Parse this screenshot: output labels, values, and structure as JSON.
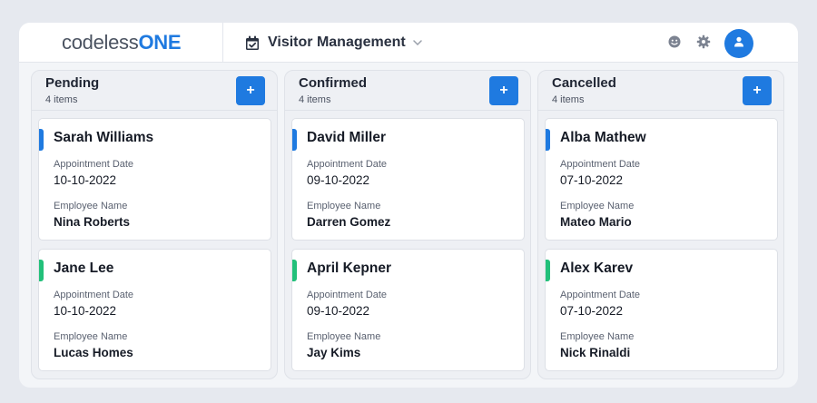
{
  "header": {
    "logo_light": "codeless",
    "logo_heavy": "ONE",
    "app_title": "Visitor Management"
  },
  "colors": {
    "accent": "#1f7ae0",
    "pending_stripe": "#1f7ae0",
    "green_stripe": "#22c07a"
  },
  "icons": [
    "calendar-check-icon",
    "chevron-down-icon",
    "smiley-icon",
    "gear-icon",
    "user-icon",
    "plus-icon"
  ],
  "labels": {
    "date": "Appointment Date",
    "employee": "Employee Name",
    "add": "+"
  },
  "columns": [
    {
      "title": "Pending",
      "count": "4 items",
      "cards": [
        {
          "name": "Sarah Williams",
          "date": "10-10-2022",
          "employee": "Nina Roberts",
          "stripe": "blue"
        },
        {
          "name": "Jane Lee",
          "date": "10-10-2022",
          "employee": "Lucas Homes",
          "stripe": "green"
        }
      ]
    },
    {
      "title": "Confirmed",
      "count": "4 items",
      "cards": [
        {
          "name": "David Miller",
          "date": "09-10-2022",
          "employee": "Darren Gomez",
          "stripe": "blue"
        },
        {
          "name": "April Kepner",
          "date": "09-10-2022",
          "employee": "Jay Kims",
          "stripe": "green"
        }
      ]
    },
    {
      "title": "Cancelled",
      "count": "4 items",
      "cards": [
        {
          "name": "Alba Mathew",
          "date": "07-10-2022",
          "employee": "Mateo Mario",
          "stripe": "blue"
        },
        {
          "name": "Alex Karev",
          "date": "07-10-2022",
          "employee": "Nick Rinaldi",
          "stripe": "green"
        }
      ]
    }
  ]
}
